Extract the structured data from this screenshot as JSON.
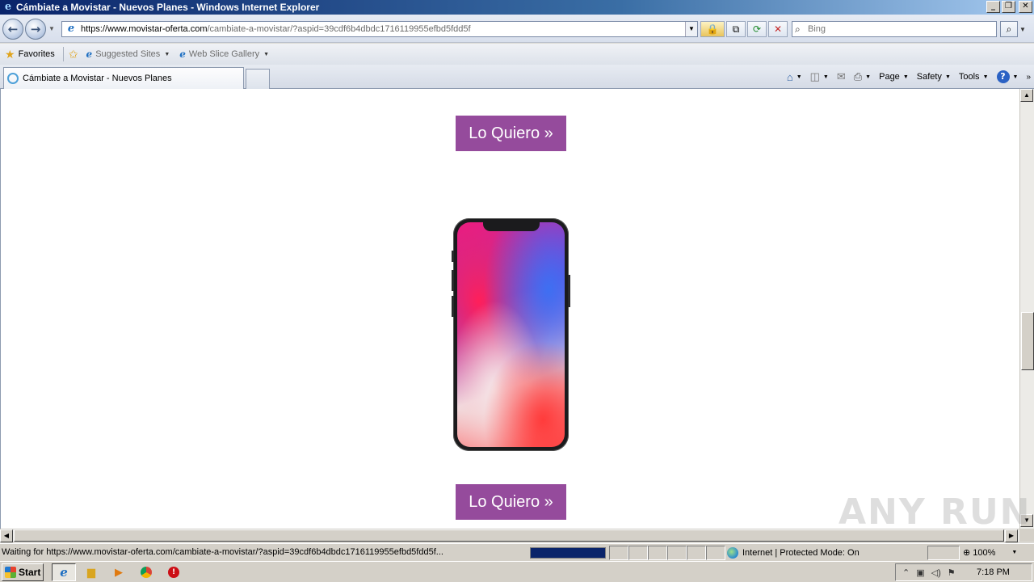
{
  "window": {
    "title": "Cámbiate a Movistar - Nuevos Planes - Windows Internet Explorer",
    "buttons": {
      "minimize": "_",
      "maximize": "❐",
      "close": "✕"
    }
  },
  "address_bar": {
    "url_host": "https://www.movistar-oferta.com",
    "url_path": "/cambiate-a-movistar/?aspid=39cdf6b4dbdc1716119955efbd5fdd5f"
  },
  "search": {
    "placeholder": "Bing"
  },
  "favorites_bar": {
    "favorites_label": "Favorites",
    "suggested_sites": "Suggested Sites",
    "web_slice_gallery": "Web Slice Gallery"
  },
  "tab": {
    "title": "Cámbiate a Movistar - Nuevos Planes"
  },
  "command_bar": {
    "page": "Page",
    "safety": "Safety",
    "tools": "Tools",
    "help": "?"
  },
  "content": {
    "cta_top": "Lo Quiero »",
    "cta_bottom": "Lo Quiero »",
    "phone_alt": "Smartphone"
  },
  "watermark": "ANY RUN",
  "status_bar": {
    "message": "Waiting for https://www.movistar-oferta.com/cambiate-a-movistar/?aspid=39cdf6b4dbdc1716119955efbd5fdd5f...",
    "zone": "Internet | Protected Mode: On",
    "zoom": "100%"
  },
  "taskbar": {
    "start": "Start",
    "clock": "7:18 PM"
  },
  "colors": {
    "cta": "#954b9c",
    "titlebar": "#0a246a",
    "progress": "#0a246a"
  }
}
